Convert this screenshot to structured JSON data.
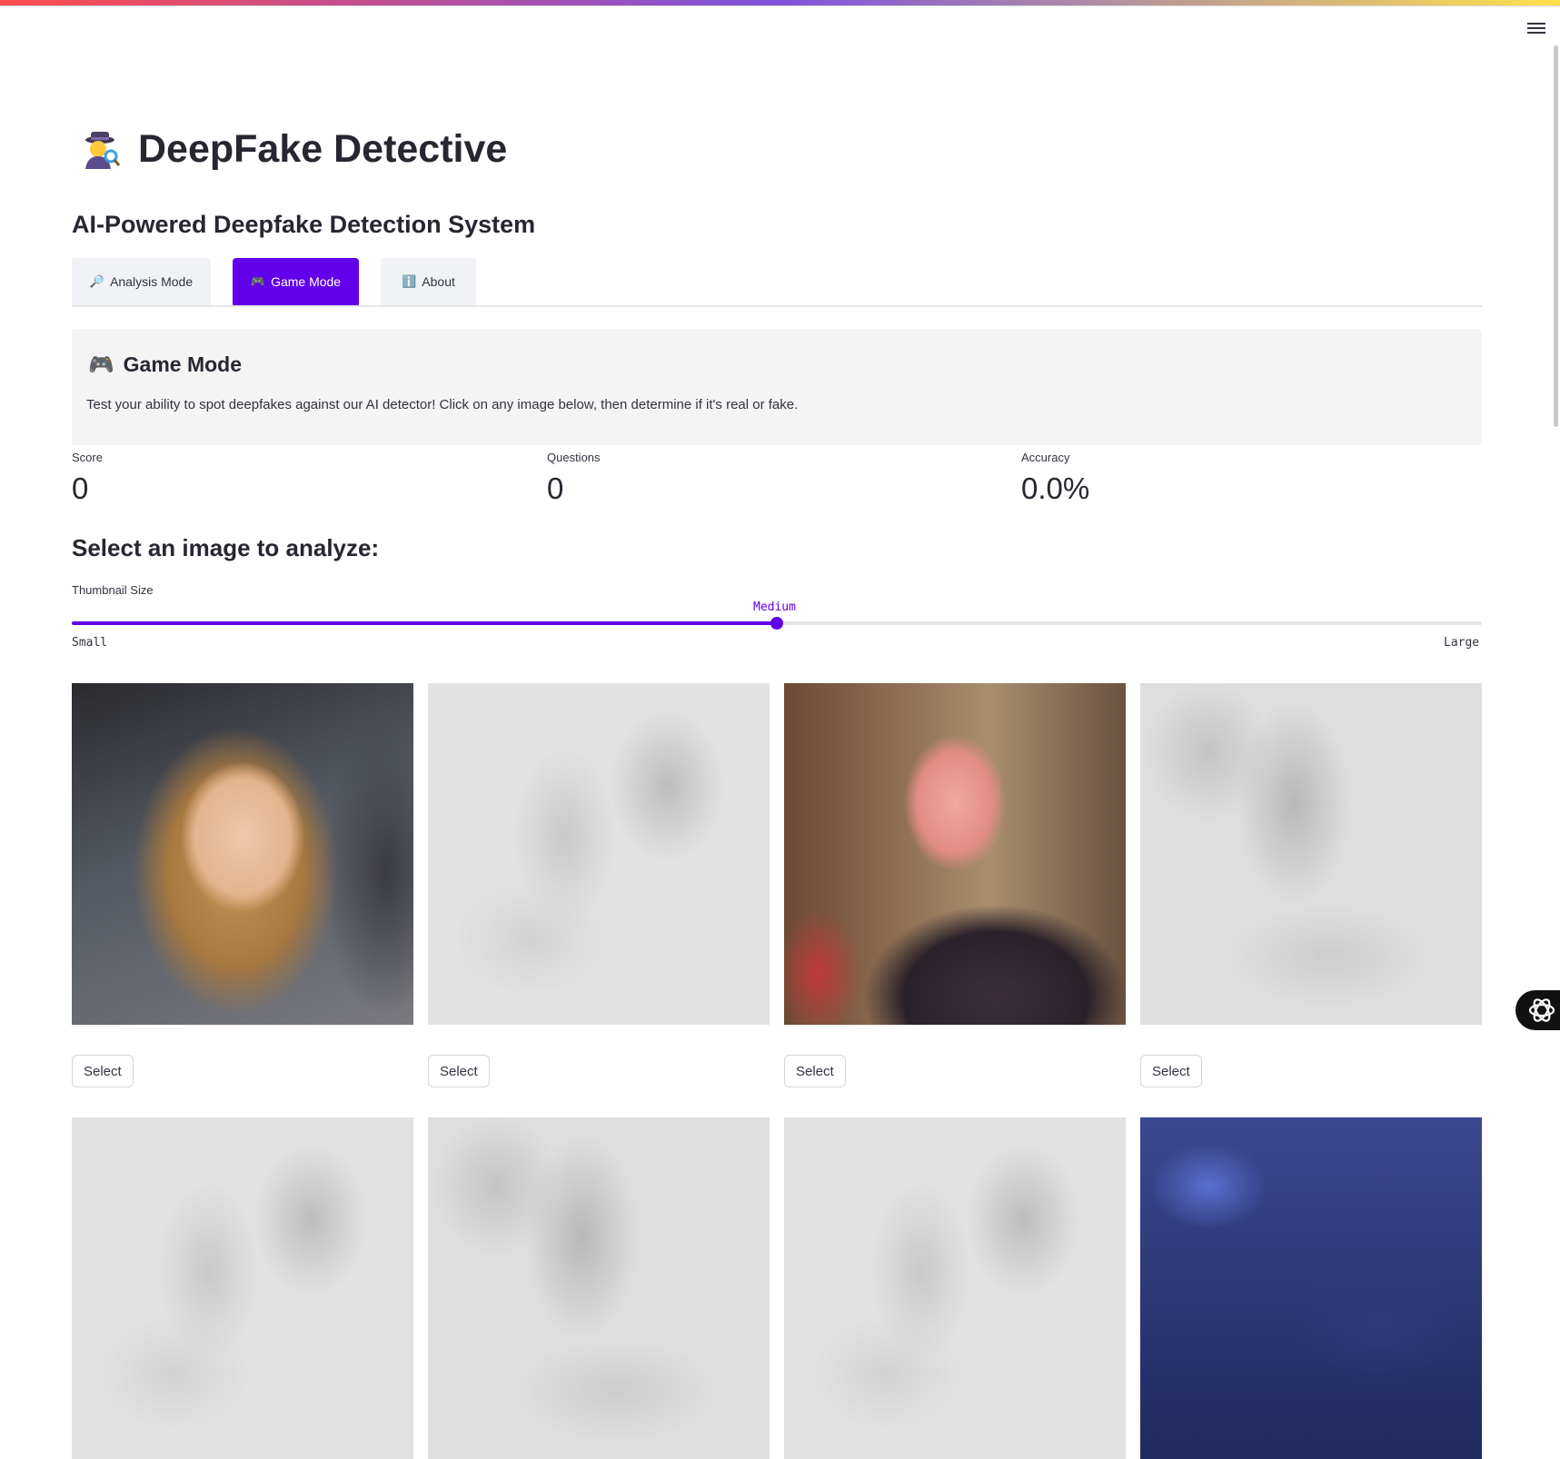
{
  "app": {
    "title": "DeepFake Detective",
    "title_icon": "detective-emoji",
    "subtitle": "AI-Powered Deepfake Detection System",
    "accent_color": "#6200ea"
  },
  "tabs": [
    {
      "label": "Analysis Mode",
      "icon": "magnifier-icon",
      "active": false
    },
    {
      "label": "Game Mode",
      "icon": "gamepad-icon",
      "active": true
    },
    {
      "label": "About",
      "icon": "info-icon",
      "active": false
    }
  ],
  "info": {
    "heading": "Game Mode",
    "text": "Test your ability to spot deepfakes against our AI detector! Click on any image below, then determine if it's real or fake."
  },
  "metrics": [
    {
      "label": "Score",
      "value": "0"
    },
    {
      "label": "Questions",
      "value": "0"
    },
    {
      "label": "Accuracy",
      "value": "0.0%"
    }
  ],
  "section": {
    "heading": "Select an image to analyze:"
  },
  "slider": {
    "label": "Thumbnail Size",
    "value": "Medium",
    "min_label": "Small",
    "max_label": "Large",
    "fraction": 0.5
  },
  "gallery": {
    "select_label": "Select",
    "images": [
      "photo-woman",
      "blurred-loading",
      "photo-man",
      "blurred-loading",
      "blurred-loading",
      "blurred-loading",
      "blurred-loading",
      "photo-crowd"
    ]
  }
}
